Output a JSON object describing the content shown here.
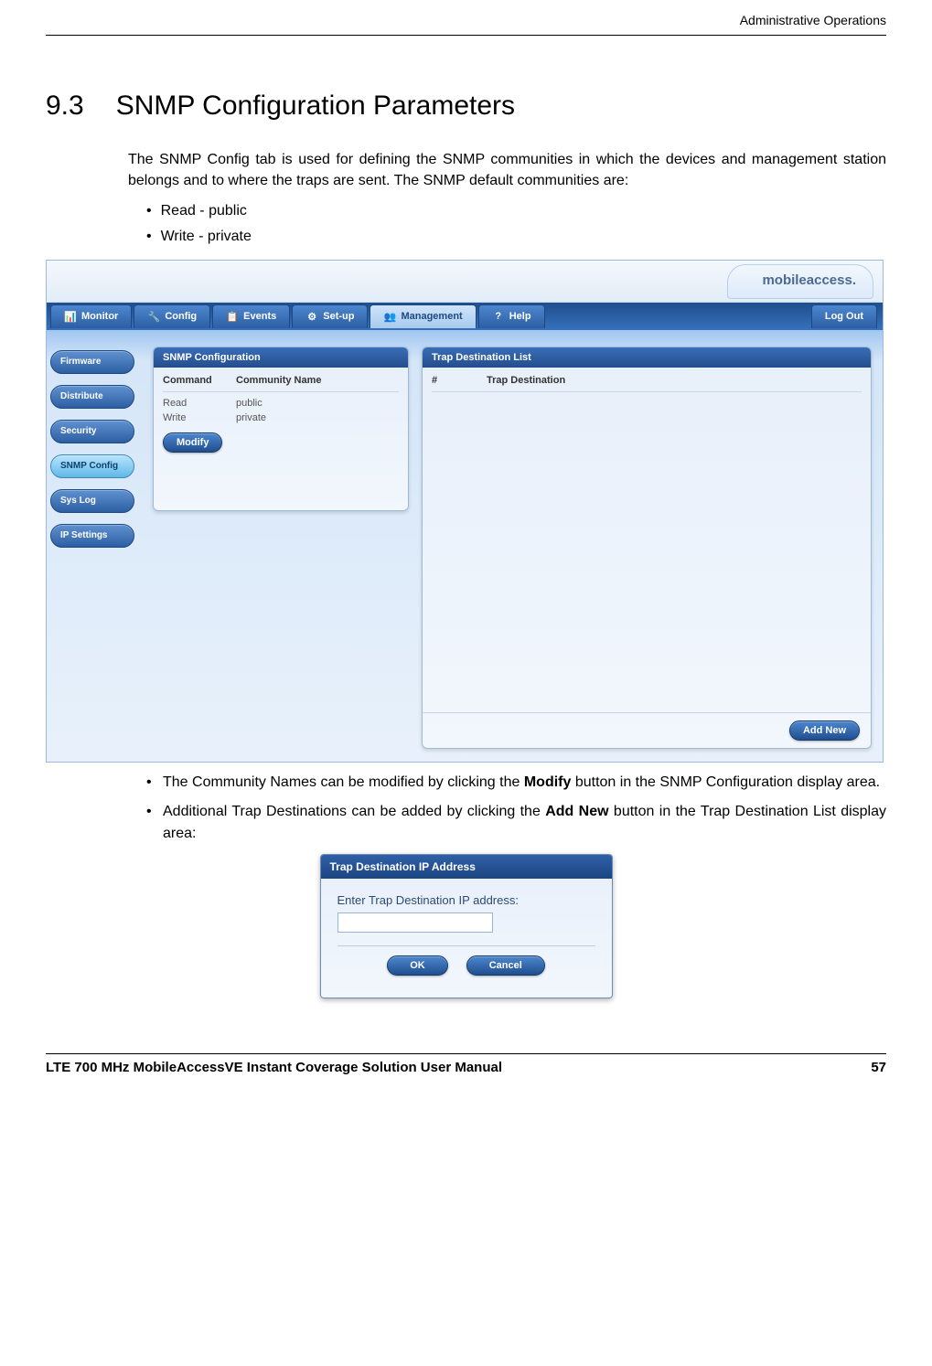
{
  "header": {
    "right": "Administrative Operations"
  },
  "section": {
    "number": "9.3",
    "title": "SNMP Configuration Parameters"
  },
  "intro": "The SNMP Config tab is used for defining the SNMP communities in which the devices and management station belongs and to where the traps are sent. The SNMP default communities are:",
  "defaults": [
    "Read - public",
    "Write - private"
  ],
  "app": {
    "logo": "mobileaccess.",
    "tabs": [
      {
        "label": "Monitor",
        "icon": "📊"
      },
      {
        "label": "Config",
        "icon": "🔧"
      },
      {
        "label": "Events",
        "icon": "📋"
      },
      {
        "label": "Set-up",
        "icon": "⚙"
      },
      {
        "label": "Management",
        "icon": "👥",
        "active": true
      },
      {
        "label": "Help",
        "icon": "?"
      }
    ],
    "logout": "Log Out",
    "sidebar": [
      {
        "label": "Firmware"
      },
      {
        "label": "Distribute"
      },
      {
        "label": "Security"
      },
      {
        "label": "SNMP Config",
        "active": true
      },
      {
        "label": "Sys Log"
      },
      {
        "label": "IP Settings"
      }
    ],
    "snmp_panel": {
      "title": "SNMP Configuration",
      "col1": "Command",
      "col2": "Community Name",
      "rows": [
        {
          "cmd": "Read",
          "name": "public"
        },
        {
          "cmd": "Write",
          "name": "private"
        }
      ],
      "modify": "Modify"
    },
    "trap_panel": {
      "title": "Trap Destination List",
      "col1": "#",
      "col2": "Trap Destination",
      "addnew": "Add New"
    }
  },
  "notes": [
    {
      "pre": "The Community Names can be modified by clicking the ",
      "bold": "Modify",
      "post": " button in the SNMP Configuration display area."
    },
    {
      "pre": "Additional Trap Destinations can be added by clicking the ",
      "bold": "Add New",
      "post": " button in the Trap Destination List display area:"
    }
  ],
  "dialog": {
    "title": "Trap Destination IP Address",
    "prompt": "Enter Trap Destination IP address:",
    "ok": "OK",
    "cancel": "Cancel"
  },
  "footer": {
    "left": "LTE 700 MHz MobileAccessVE Instant Coverage Solution User Manual",
    "right": "57"
  }
}
